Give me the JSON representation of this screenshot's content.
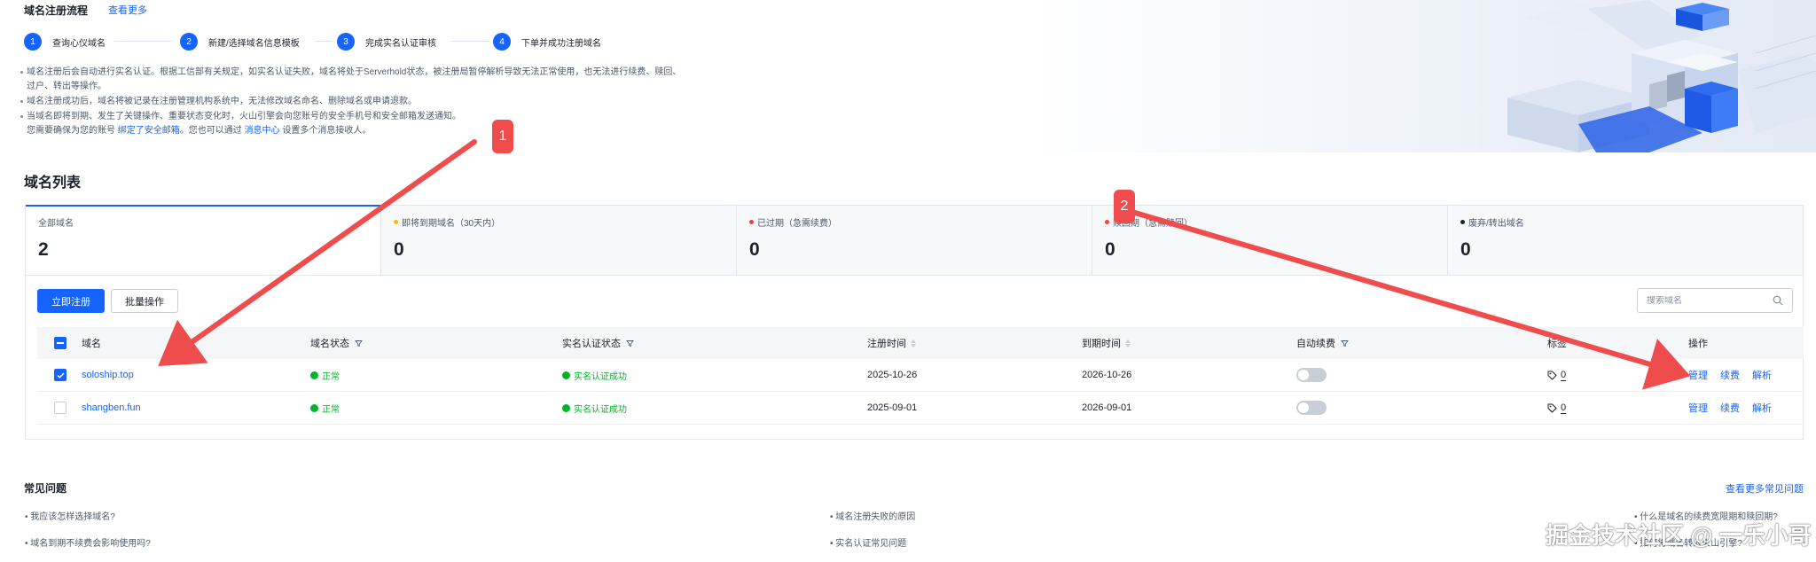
{
  "flow": {
    "title": "域名注册流程",
    "more_link": "查看更多",
    "steps": [
      {
        "num": "1",
        "label": "查询心仪域名"
      },
      {
        "num": "2",
        "label": "新建/选择域名信息模板"
      },
      {
        "num": "3",
        "label": "完成实名认证审核"
      },
      {
        "num": "4",
        "label": "下单并成功注册域名"
      }
    ]
  },
  "notices": [
    "域名注册后会自动进行实名认证。根据工信部有关规定，如实名认证失败，域名将处于Serverhold状态，被注册局暂停解析导致无法正常使用，也无法进行续费、赎回、",
    "过户、转出等操作。",
    "域名注册成功后，域名将被记录在注册管理机构系统中，无法修改域名命名、删除域名或申请退款。",
    "当域名即将到期、发生了关键操作、重要状态变化时，火山引擎会向您账号的安全手机号和安全邮箱发送通知。"
  ],
  "notice_last": {
    "prefix": "您需要确保为您的账号",
    "link1": "绑定了安全邮箱",
    "middle": "。您也可以通过",
    "link2": "消息中心",
    "suffix": "设置多个消息接收人。"
  },
  "list": {
    "title": "域名列表",
    "stats": [
      {
        "label": "全部域名",
        "value": "2",
        "dot": ""
      },
      {
        "label": "即将到期域名（30天内）",
        "value": "0",
        "dot": "#f7ba1e"
      },
      {
        "label": "已过期（急需续费）",
        "value": "0",
        "dot": "#f53f3f"
      },
      {
        "label": "赎回期（急需赎回）",
        "value": "0",
        "dot": "#f53f3f"
      },
      {
        "label": "废弃/转出域名",
        "value": "0",
        "dot": "#1d2129"
      }
    ],
    "register_button": "立即注册",
    "batch_button": "批量操作",
    "search_placeholder": "搜索域名",
    "columns": {
      "domain": "域名",
      "domain_status": "域名状态",
      "verify_status": "实名认证状态",
      "register_time": "注册时间",
      "expire_time": "到期时间",
      "auto_renew": "自动续费",
      "tags": "标签",
      "actions": "操作"
    },
    "rows": [
      {
        "domain": "soloship.top",
        "status": "正常",
        "verify": "实名认证成功",
        "registered": "2025-10-26",
        "expires": "2026-10-26",
        "tags": "0",
        "checked": true
      },
      {
        "domain": "shangben.fun",
        "status": "正常",
        "verify": "实名认证成功",
        "registered": "2025-09-01",
        "expires": "2026-09-01",
        "tags": "0",
        "checked": false
      }
    ],
    "actions": {
      "manage": "管理",
      "renew": "续费",
      "resolve": "解析"
    }
  },
  "faq": {
    "title": "常见问题",
    "more_link": "查看更多常见问题",
    "items": [
      "我应该怎样选择域名?",
      "域名注册失败的原因",
      "什么是域名的续费宽限期和赎回期?",
      "域名到期不续费会影响使用吗?",
      "实名认证常见问题",
      "如何将域名转入火山引擎?"
    ]
  },
  "annotations": {
    "marker1": "1",
    "marker2": "2",
    "accent": "#ef4d4d"
  },
  "watermark": "掘金技术社区 @ 一乐小哥",
  "colors": {
    "primary": "#1664ff",
    "success": "#00b42a"
  }
}
